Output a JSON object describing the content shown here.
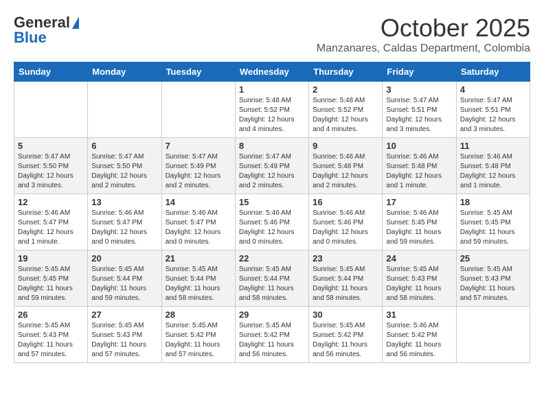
{
  "header": {
    "logo_general": "General",
    "logo_blue": "Blue",
    "month": "October 2025",
    "location": "Manzanares, Caldas Department, Colombia"
  },
  "days_of_week": [
    "Sunday",
    "Monday",
    "Tuesday",
    "Wednesday",
    "Thursday",
    "Friday",
    "Saturday"
  ],
  "weeks": [
    [
      {
        "day": "",
        "info": ""
      },
      {
        "day": "",
        "info": ""
      },
      {
        "day": "",
        "info": ""
      },
      {
        "day": "1",
        "info": "Sunrise: 5:48 AM\nSunset: 5:52 PM\nDaylight: 12 hours\nand 4 minutes."
      },
      {
        "day": "2",
        "info": "Sunrise: 5:48 AM\nSunset: 5:52 PM\nDaylight: 12 hours\nand 4 minutes."
      },
      {
        "day": "3",
        "info": "Sunrise: 5:47 AM\nSunset: 5:51 PM\nDaylight: 12 hours\nand 3 minutes."
      },
      {
        "day": "4",
        "info": "Sunrise: 5:47 AM\nSunset: 5:51 PM\nDaylight: 12 hours\nand 3 minutes."
      }
    ],
    [
      {
        "day": "5",
        "info": "Sunrise: 5:47 AM\nSunset: 5:50 PM\nDaylight: 12 hours\nand 3 minutes."
      },
      {
        "day": "6",
        "info": "Sunrise: 5:47 AM\nSunset: 5:50 PM\nDaylight: 12 hours\nand 2 minutes."
      },
      {
        "day": "7",
        "info": "Sunrise: 5:47 AM\nSunset: 5:49 PM\nDaylight: 12 hours\nand 2 minutes."
      },
      {
        "day": "8",
        "info": "Sunrise: 5:47 AM\nSunset: 5:49 PM\nDaylight: 12 hours\nand 2 minutes."
      },
      {
        "day": "9",
        "info": "Sunrise: 5:46 AM\nSunset: 5:48 PM\nDaylight: 12 hours\nand 2 minutes."
      },
      {
        "day": "10",
        "info": "Sunrise: 5:46 AM\nSunset: 5:48 PM\nDaylight: 12 hours\nand 1 minute."
      },
      {
        "day": "11",
        "info": "Sunrise: 5:46 AM\nSunset: 5:48 PM\nDaylight: 12 hours\nand 1 minute."
      }
    ],
    [
      {
        "day": "12",
        "info": "Sunrise: 5:46 AM\nSunset: 5:47 PM\nDaylight: 12 hours\nand 1 minute."
      },
      {
        "day": "13",
        "info": "Sunrise: 5:46 AM\nSunset: 5:47 PM\nDaylight: 12 hours\nand 0 minutes."
      },
      {
        "day": "14",
        "info": "Sunrise: 5:46 AM\nSunset: 5:47 PM\nDaylight: 12 hours\nand 0 minutes."
      },
      {
        "day": "15",
        "info": "Sunrise: 5:46 AM\nSunset: 5:46 PM\nDaylight: 12 hours\nand 0 minutes."
      },
      {
        "day": "16",
        "info": "Sunrise: 5:46 AM\nSunset: 5:46 PM\nDaylight: 12 hours\nand 0 minutes."
      },
      {
        "day": "17",
        "info": "Sunrise: 5:46 AM\nSunset: 5:45 PM\nDaylight: 11 hours\nand 59 minutes."
      },
      {
        "day": "18",
        "info": "Sunrise: 5:45 AM\nSunset: 5:45 PM\nDaylight: 11 hours\nand 59 minutes."
      }
    ],
    [
      {
        "day": "19",
        "info": "Sunrise: 5:45 AM\nSunset: 5:45 PM\nDaylight: 11 hours\nand 59 minutes."
      },
      {
        "day": "20",
        "info": "Sunrise: 5:45 AM\nSunset: 5:44 PM\nDaylight: 11 hours\nand 59 minutes."
      },
      {
        "day": "21",
        "info": "Sunrise: 5:45 AM\nSunset: 5:44 PM\nDaylight: 11 hours\nand 58 minutes."
      },
      {
        "day": "22",
        "info": "Sunrise: 5:45 AM\nSunset: 5:44 PM\nDaylight: 11 hours\nand 58 minutes."
      },
      {
        "day": "23",
        "info": "Sunrise: 5:45 AM\nSunset: 5:44 PM\nDaylight: 11 hours\nand 58 minutes."
      },
      {
        "day": "24",
        "info": "Sunrise: 5:45 AM\nSunset: 5:43 PM\nDaylight: 11 hours\nand 58 minutes."
      },
      {
        "day": "25",
        "info": "Sunrise: 5:45 AM\nSunset: 5:43 PM\nDaylight: 11 hours\nand 57 minutes."
      }
    ],
    [
      {
        "day": "26",
        "info": "Sunrise: 5:45 AM\nSunset: 5:43 PM\nDaylight: 11 hours\nand 57 minutes."
      },
      {
        "day": "27",
        "info": "Sunrise: 5:45 AM\nSunset: 5:43 PM\nDaylight: 11 hours\nand 57 minutes."
      },
      {
        "day": "28",
        "info": "Sunrise: 5:45 AM\nSunset: 5:42 PM\nDaylight: 11 hours\nand 57 minutes."
      },
      {
        "day": "29",
        "info": "Sunrise: 5:45 AM\nSunset: 5:42 PM\nDaylight: 11 hours\nand 56 minutes."
      },
      {
        "day": "30",
        "info": "Sunrise: 5:45 AM\nSunset: 5:42 PM\nDaylight: 11 hours\nand 56 minutes."
      },
      {
        "day": "31",
        "info": "Sunrise: 5:46 AM\nSunset: 5:42 PM\nDaylight: 11 hours\nand 56 minutes."
      },
      {
        "day": "",
        "info": ""
      }
    ]
  ]
}
